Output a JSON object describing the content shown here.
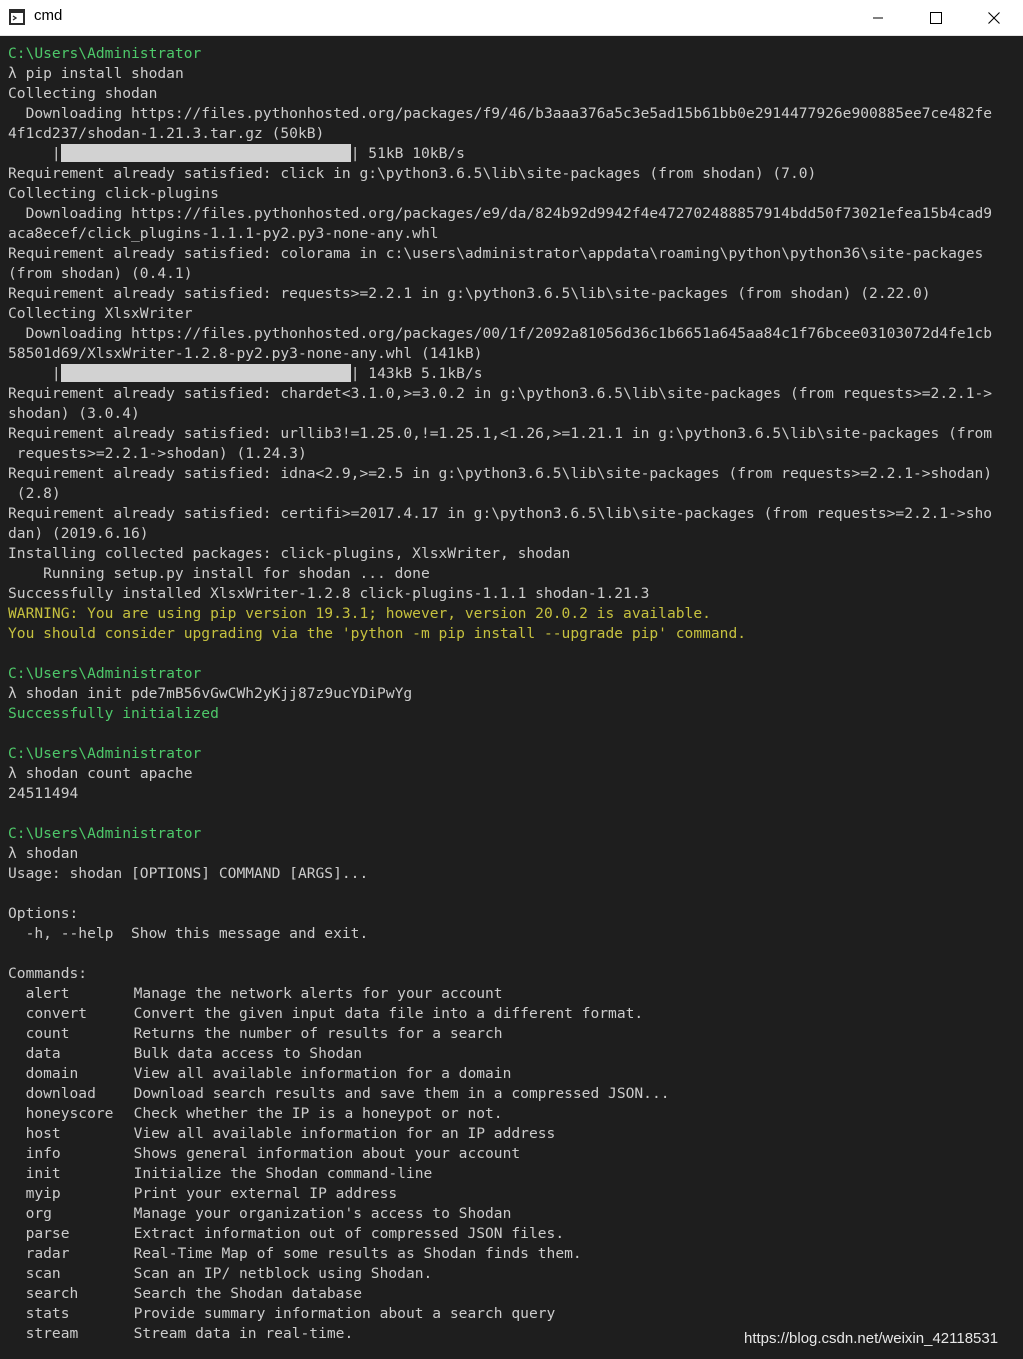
{
  "window": {
    "title": "cmd",
    "icon": "console-app-icon",
    "controls": [
      "minimize-icon",
      "maximize-icon",
      "close-icon"
    ]
  },
  "console": {
    "prompt_path": "C:\\Users\\Administrator",
    "prompt_symbol": "λ",
    "lines": [
      {
        "t": "path"
      },
      {
        "t": "cmd",
        "text": "pip install shodan"
      },
      {
        "t": "plain",
        "text": "Collecting shodan"
      },
      {
        "t": "plain",
        "text": "  Downloading https://files.pythonhosted.org/packages/f9/46/b3aaa376a5c3e5ad15b61bb0e2914477926e900885ee7ce482fe"
      },
      {
        "t": "plain",
        "text": "4f1cd237/shodan-1.21.3.tar.gz (50kB)"
      },
      {
        "t": "bar",
        "pre": "     |",
        "post": "| 51kB 10kB/s"
      },
      {
        "t": "plain",
        "text": "Requirement already satisfied: click in g:\\python3.6.5\\lib\\site-packages (from shodan) (7.0)"
      },
      {
        "t": "plain",
        "text": "Collecting click-plugins"
      },
      {
        "t": "plain",
        "text": "  Downloading https://files.pythonhosted.org/packages/e9/da/824b92d9942f4e472702488857914bdd50f73021efea15b4cad9"
      },
      {
        "t": "plain",
        "text": "aca8ecef/click_plugins-1.1.1-py2.py3-none-any.whl"
      },
      {
        "t": "plain",
        "text": "Requirement already satisfied: colorama in c:\\users\\administrator\\appdata\\roaming\\python\\python36\\site-packages"
      },
      {
        "t": "plain",
        "text": "(from shodan) (0.4.1)"
      },
      {
        "t": "plain",
        "text": "Requirement already satisfied: requests>=2.2.1 in g:\\python3.6.5\\lib\\site-packages (from shodan) (2.22.0)"
      },
      {
        "t": "plain",
        "text": "Collecting XlsxWriter"
      },
      {
        "t": "plain",
        "text": "  Downloading https://files.pythonhosted.org/packages/00/1f/2092a81056d36c1b6651a645aa84c1f76bcee03103072d4fe1cb"
      },
      {
        "t": "plain",
        "text": "58501d69/XlsxWriter-1.2.8-py2.py3-none-any.whl (141kB)"
      },
      {
        "t": "bar",
        "pre": "     |",
        "post": "| 143kB 5.1kB/s"
      },
      {
        "t": "plain",
        "text": "Requirement already satisfied: chardet<3.1.0,>=3.0.2 in g:\\python3.6.5\\lib\\site-packages (from requests>=2.2.1->"
      },
      {
        "t": "plain",
        "text": "shodan) (3.0.4)"
      },
      {
        "t": "plain",
        "text": "Requirement already satisfied: urllib3!=1.25.0,!=1.25.1,<1.26,>=1.21.1 in g:\\python3.6.5\\lib\\site-packages (from"
      },
      {
        "t": "plain",
        "text": " requests>=2.2.1->shodan) (1.24.3)"
      },
      {
        "t": "plain",
        "text": "Requirement already satisfied: idna<2.9,>=2.5 in g:\\python3.6.5\\lib\\site-packages (from requests>=2.2.1->shodan)"
      },
      {
        "t": "plain",
        "text": " (2.8)"
      },
      {
        "t": "plain",
        "text": "Requirement already satisfied: certifi>=2017.4.17 in g:\\python3.6.5\\lib\\site-packages (from requests>=2.2.1->sho"
      },
      {
        "t": "plain",
        "text": "dan) (2019.6.16)"
      },
      {
        "t": "plain",
        "text": "Installing collected packages: click-plugins, XlsxWriter, shodan"
      },
      {
        "t": "plain",
        "text": "    Running setup.py install for shodan ... done"
      },
      {
        "t": "plain",
        "text": "Successfully installed XlsxWriter-1.2.8 click-plugins-1.1.1 shodan-1.21.3"
      },
      {
        "t": "yellow",
        "text": "WARNING: You are using pip version 19.3.1; however, version 20.0.2 is available."
      },
      {
        "t": "yellow",
        "text": "You should consider upgrading via the 'python -m pip install --upgrade pip' command."
      },
      {
        "t": "blank"
      },
      {
        "t": "path"
      },
      {
        "t": "cmd",
        "text": "shodan init pde7mB56vGwCWh2yKjj87z9ucYDiPwYg"
      },
      {
        "t": "green",
        "text": "Successfully initialized"
      },
      {
        "t": "blank"
      },
      {
        "t": "path"
      },
      {
        "t": "cmd",
        "text": "shodan count apache"
      },
      {
        "t": "plain",
        "text": "24511494"
      },
      {
        "t": "blank"
      },
      {
        "t": "path"
      },
      {
        "t": "cmd",
        "text": "shodan"
      },
      {
        "t": "plain",
        "text": "Usage: shodan [OPTIONS] COMMAND [ARGS]..."
      },
      {
        "t": "blank"
      },
      {
        "t": "plain",
        "text": "Options:"
      },
      {
        "t": "plain",
        "text": "  -h, --help  Show this message and exit."
      },
      {
        "t": "blank"
      },
      {
        "t": "plain",
        "text": "Commands:"
      }
    ],
    "commands": [
      {
        "name": "alert",
        "desc": "Manage the network alerts for your account"
      },
      {
        "name": "convert",
        "desc": "Convert the given input data file into a different format."
      },
      {
        "name": "count",
        "desc": "Returns the number of results for a search"
      },
      {
        "name": "data",
        "desc": "Bulk data access to Shodan"
      },
      {
        "name": "domain",
        "desc": "View all available information for a domain"
      },
      {
        "name": "download",
        "desc": "Download search results and save them in a compressed JSON..."
      },
      {
        "name": "honeyscore",
        "desc": "Check whether the IP is a honeypot or not."
      },
      {
        "name": "host",
        "desc": "View all available information for an IP address"
      },
      {
        "name": "info",
        "desc": "Shows general information about your account"
      },
      {
        "name": "init",
        "desc": "Initialize the Shodan command-line"
      },
      {
        "name": "myip",
        "desc": "Print your external IP address"
      },
      {
        "name": "org",
        "desc": "Manage your organization's access to Shodan"
      },
      {
        "name": "parse",
        "desc": "Extract information out of compressed JSON files."
      },
      {
        "name": "radar",
        "desc": "Real-Time Map of some results as Shodan finds them."
      },
      {
        "name": "scan",
        "desc": "Scan an IP/ netblock using Shodan."
      },
      {
        "name": "search",
        "desc": "Search the Shodan database"
      },
      {
        "name": "stats",
        "desc": "Provide summary information about a search query"
      },
      {
        "name": "stream",
        "desc": "Stream data in real-time."
      }
    ]
  },
  "watermark": "https://blog.csdn.net/weixin_42118531",
  "colors": {
    "background": "#1e1e1e",
    "text": "#cccccc",
    "prompt_green": "#4ec96a",
    "warning_yellow": "#c6c13f",
    "progress_bar": "#d2d2d2"
  }
}
